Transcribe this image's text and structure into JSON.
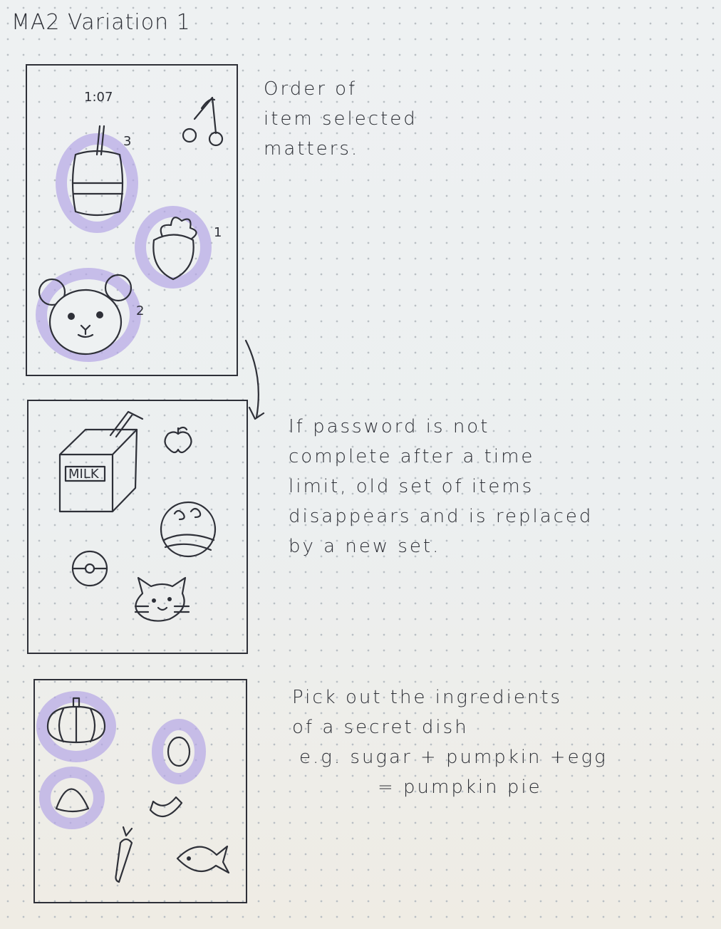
{
  "title": "MA2 Variation 1",
  "panel1": {
    "time": "1:07",
    "order_labels": [
      "3",
      "1",
      "2"
    ]
  },
  "panel2": {
    "milk_label": "MILK"
  },
  "notes": {
    "note1": [
      "Order of",
      "item selected",
      "matters."
    ],
    "note2": [
      "If password is not",
      "complete after a time",
      "limit, old set of items",
      "disappears and is replaced",
      "by a new set."
    ],
    "note3": [
      "Pick out the ingredients",
      "of a secret dish",
      "e.g. sugar + pumpkin +egg",
      "= pumpkin pie"
    ]
  },
  "colors": {
    "ink": "#2e3038",
    "highlight": "#b5a6e6",
    "paper": "#eef1f2"
  }
}
